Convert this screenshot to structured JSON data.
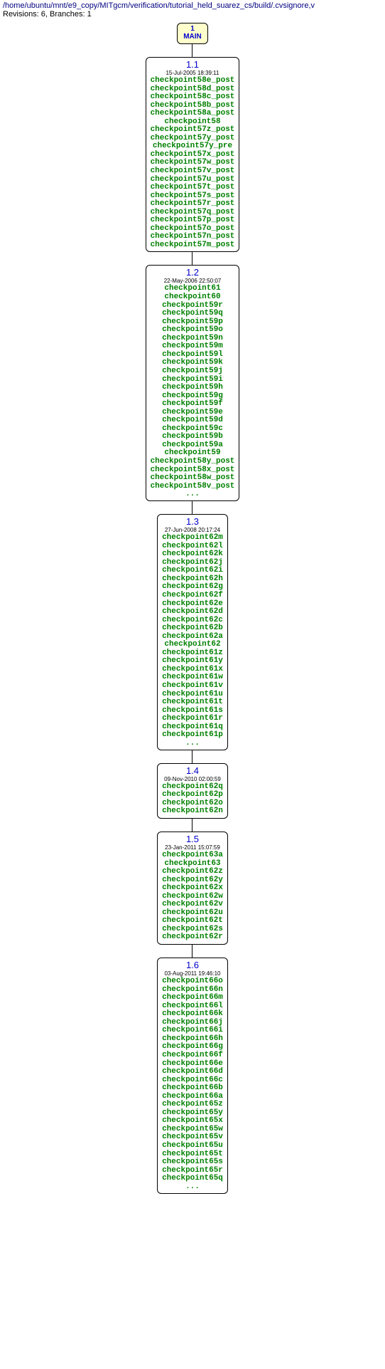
{
  "header": {
    "path": "/home/ubuntu/mnt/e9_copy/MITgcm/verification/tutorial_held_suarez_cs/build/.cvsignore,v",
    "stats": "Revisions: 6, Branches: 1"
  },
  "main": {
    "num": "1",
    "label": "MAIN"
  },
  "revisions": [
    {
      "version": "1.1",
      "date": "15-Jul-2005 18:39:11",
      "tags": [
        "checkpoint58e_post",
        "checkpoint58d_post",
        "checkpoint58c_post",
        "checkpoint58b_post",
        "checkpoint58a_post",
        "checkpoint58",
        "checkpoint57z_post",
        "checkpoint57y_post",
        "checkpoint57y_pre",
        "checkpoint57x_post",
        "checkpoint57w_post",
        "checkpoint57v_post",
        "checkpoint57u_post",
        "checkpoint57t_post",
        "checkpoint57s_post",
        "checkpoint57r_post",
        "checkpoint57q_post",
        "checkpoint57p_post",
        "checkpoint57o_post",
        "checkpoint57n_post",
        "checkpoint57m_post"
      ],
      "ellipsis": false
    },
    {
      "version": "1.2",
      "date": "22-May-2006 22:50:07",
      "tags": [
        "checkpoint61",
        "checkpoint60",
        "checkpoint59r",
        "checkpoint59q",
        "checkpoint59p",
        "checkpoint59o",
        "checkpoint59n",
        "checkpoint59m",
        "checkpoint59l",
        "checkpoint59k",
        "checkpoint59j",
        "checkpoint59i",
        "checkpoint59h",
        "checkpoint59g",
        "checkpoint59f",
        "checkpoint59e",
        "checkpoint59d",
        "checkpoint59c",
        "checkpoint59b",
        "checkpoint59a",
        "checkpoint59",
        "checkpoint58y_post",
        "checkpoint58x_post",
        "checkpoint58w_post",
        "checkpoint58v_post"
      ],
      "ellipsis": true
    },
    {
      "version": "1.3",
      "date": "27-Jun-2008 20:17:24",
      "tags": [
        "checkpoint62m",
        "checkpoint62l",
        "checkpoint62k",
        "checkpoint62j",
        "checkpoint62i",
        "checkpoint62h",
        "checkpoint62g",
        "checkpoint62f",
        "checkpoint62e",
        "checkpoint62d",
        "checkpoint62c",
        "checkpoint62b",
        "checkpoint62a",
        "checkpoint62",
        "checkpoint61z",
        "checkpoint61y",
        "checkpoint61x",
        "checkpoint61w",
        "checkpoint61v",
        "checkpoint61u",
        "checkpoint61t",
        "checkpoint61s",
        "checkpoint61r",
        "checkpoint61q",
        "checkpoint61p"
      ],
      "ellipsis": true
    },
    {
      "version": "1.4",
      "date": "09-Nov-2010 02:00:59",
      "tags": [
        "checkpoint62q",
        "checkpoint62p",
        "checkpoint62o",
        "checkpoint62n"
      ],
      "ellipsis": false
    },
    {
      "version": "1.5",
      "date": "23-Jan-2011 15:07:59",
      "tags": [
        "checkpoint63a",
        "checkpoint63",
        "checkpoint62z",
        "checkpoint62y",
        "checkpoint62x",
        "checkpoint62w",
        "checkpoint62v",
        "checkpoint62u",
        "checkpoint62t",
        "checkpoint62s",
        "checkpoint62r"
      ],
      "ellipsis": false
    },
    {
      "version": "1.6",
      "date": "03-Aug-2011 19:46:10",
      "tags": [
        "checkpoint66o",
        "checkpoint66n",
        "checkpoint66m",
        "checkpoint66l",
        "checkpoint66k",
        "checkpoint66j",
        "checkpoint66i",
        "checkpoint66h",
        "checkpoint66g",
        "checkpoint66f",
        "checkpoint66e",
        "checkpoint66d",
        "checkpoint66c",
        "checkpoint66b",
        "checkpoint66a",
        "checkpoint65z",
        "checkpoint65y",
        "checkpoint65x",
        "checkpoint65w",
        "checkpoint65v",
        "checkpoint65u",
        "checkpoint65t",
        "checkpoint65s",
        "checkpoint65r",
        "checkpoint65q"
      ],
      "ellipsis": true
    }
  ]
}
